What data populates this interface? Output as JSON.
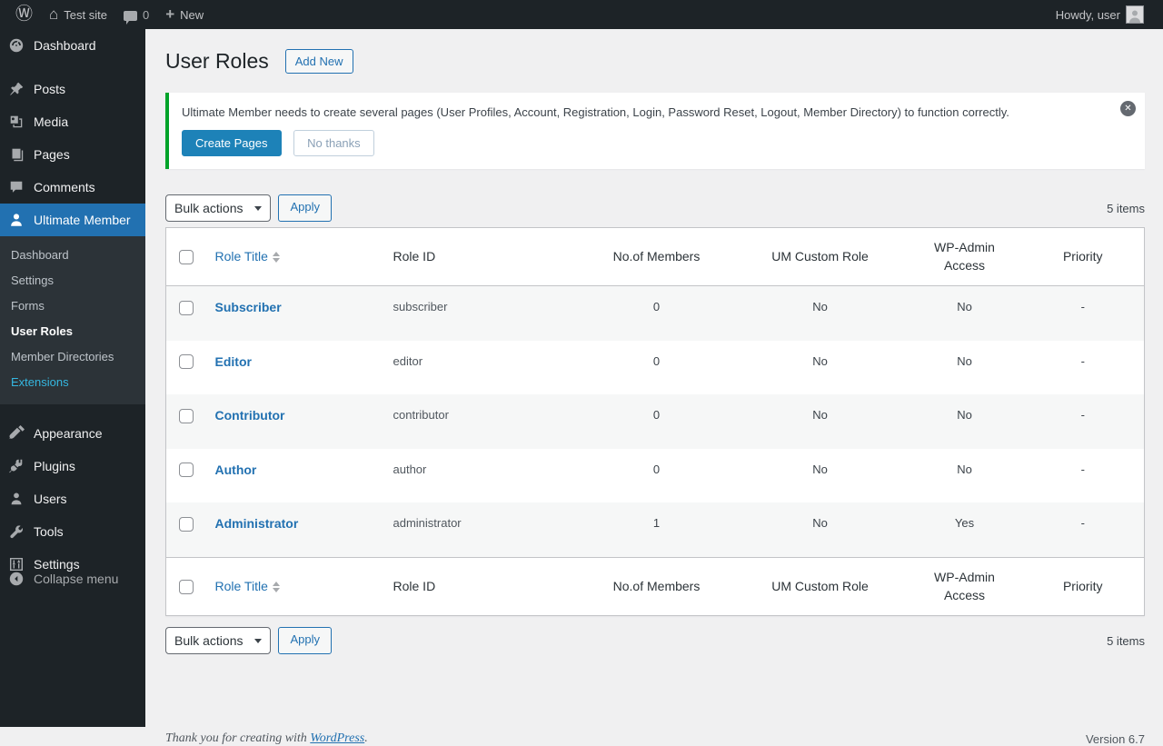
{
  "colors": {
    "accent_blue": "#2271b1",
    "primary_button_blue": "#1d82b8",
    "notice_green": "#00a32a",
    "admin_bar_bg": "#1d2327",
    "submenu_bg": "#2c3338",
    "stripe_gray": "#f6f7f7",
    "extensions_cyan": "#35b7e0"
  },
  "icons": {
    "wordpress": "Ⓦ",
    "home": "⌂",
    "plus": "+",
    "dismiss": "✕"
  },
  "admin_bar": {
    "site_name": "Test site",
    "comments_count": "0",
    "new_label": "New",
    "howdy": "Howdy, user"
  },
  "sidebar": {
    "items": [
      {
        "label": "Dashboard"
      },
      {
        "label": "Posts"
      },
      {
        "label": "Media"
      },
      {
        "label": "Pages"
      },
      {
        "label": "Comments"
      },
      {
        "label": "Ultimate Member"
      },
      {
        "label": "Appearance"
      },
      {
        "label": "Plugins"
      },
      {
        "label": "Users"
      },
      {
        "label": "Tools"
      },
      {
        "label": "Settings"
      },
      {
        "label": "Collapse menu"
      }
    ],
    "submenu": [
      {
        "label": "Dashboard"
      },
      {
        "label": "Settings"
      },
      {
        "label": "Forms"
      },
      {
        "label": "User Roles"
      },
      {
        "label": "Member Directories"
      },
      {
        "label": "Extensions"
      }
    ]
  },
  "page": {
    "title": "User Roles",
    "add_new_label": "Add New"
  },
  "notice": {
    "message": "Ultimate Member needs to create several pages (User Profiles, Account, Registration, Login, Password Reset, Logout, Member Directory) to function correctly.",
    "create_pages_label": "Create Pages",
    "no_thanks_label": "No thanks"
  },
  "tablenav": {
    "bulk_actions_label": "Bulk actions",
    "apply_label": "Apply",
    "items_count": "5 items"
  },
  "table": {
    "headers": [
      "Role Title",
      "Role ID",
      "No.of Members",
      "UM Custom Role",
      "WP-Admin Access",
      "Priority"
    ],
    "rows": [
      {
        "title": "Subscriber",
        "id": "subscriber",
        "members": "0",
        "custom_role": "No",
        "wp_admin_access": "No",
        "priority": "-"
      },
      {
        "title": "Editor",
        "id": "editor",
        "members": "0",
        "custom_role": "No",
        "wp_admin_access": "No",
        "priority": "-"
      },
      {
        "title": "Contributor",
        "id": "contributor",
        "members": "0",
        "custom_role": "No",
        "wp_admin_access": "No",
        "priority": "-"
      },
      {
        "title": "Author",
        "id": "author",
        "members": "0",
        "custom_role": "No",
        "wp_admin_access": "No",
        "priority": "-"
      },
      {
        "title": "Administrator",
        "id": "administrator",
        "members": "1",
        "custom_role": "No",
        "wp_admin_access": "Yes",
        "priority": "-"
      }
    ]
  },
  "footer": {
    "thanks_prefix": "Thank you for creating with",
    "wordpress_link_label": "WordPress",
    "thanks_suffix": ".",
    "version": "Version 6.7"
  }
}
